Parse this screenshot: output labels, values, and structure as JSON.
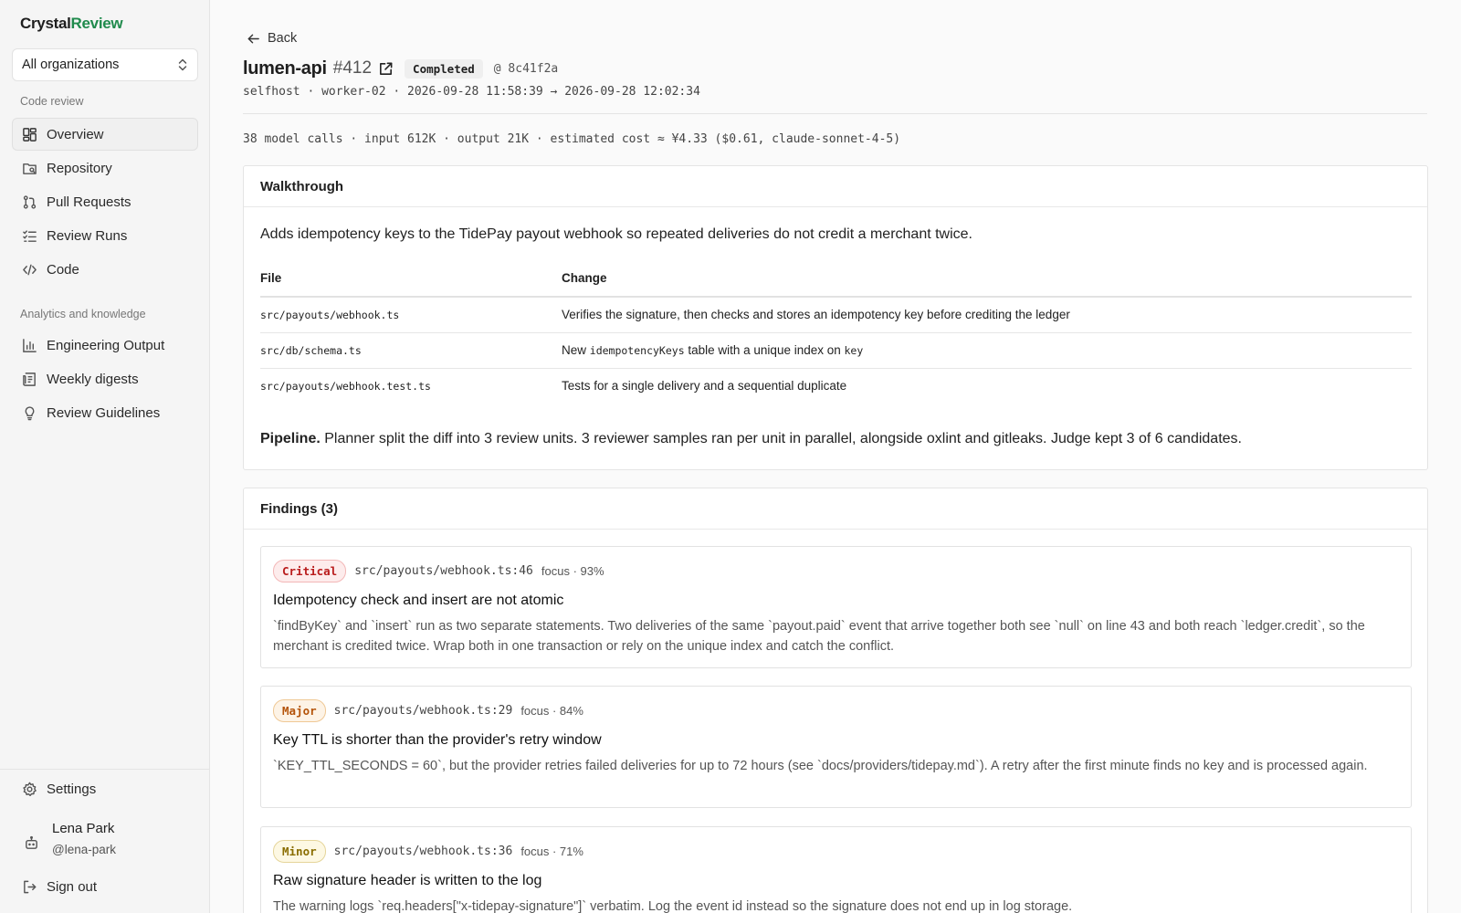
{
  "brand": {
    "part1": "Crystal",
    "part2": "Review"
  },
  "org_select": {
    "value": "All organizations"
  },
  "sidebar": {
    "section_code_review": "Code review",
    "code_items": [
      {
        "label": "Overview",
        "icon": "overview-grid-icon"
      },
      {
        "label": "Repository",
        "icon": "repository-icon"
      },
      {
        "label": "Pull Requests",
        "icon": "pull-request-icon"
      },
      {
        "label": "Review Runs",
        "icon": "checklist-icon"
      },
      {
        "label": "Code",
        "icon": "code-icon"
      }
    ],
    "section_analytics": "Analytics and knowledge",
    "analytics_items": [
      {
        "label": "Engineering Output",
        "icon": "bar-chart-icon"
      },
      {
        "label": "Weekly digests",
        "icon": "digest-icon"
      },
      {
        "label": "Review Guidelines",
        "icon": "lightbulb-icon"
      }
    ],
    "settings_label": "Settings",
    "user": {
      "name": "Lena Park",
      "handle": "@lena-park"
    },
    "signout_label": "Sign out"
  },
  "header": {
    "back_label": "Back",
    "repo": "lumen-api",
    "pr_number": "#412",
    "status": "Completed",
    "commit": "@ 8c41f2a",
    "meta": "selfhost · worker-02 · 2026-09-28 11:58:39 → 2026-09-28 12:02:34",
    "cost": "38 model calls · input 612K · output 21K · estimated cost ≈ ¥4.33 ($0.61, claude-sonnet-4-5)"
  },
  "walkthrough": {
    "title": "Walkthrough",
    "summary": "Adds idempotency keys to the TidePay payout webhook so repeated deliveries do not credit a merchant twice.",
    "col_file": "File",
    "col_change": "Change",
    "rows": [
      {
        "file": "src/payouts/webhook.ts",
        "change": "Verifies the signature, then checks and stores an idempotency key before crediting the ledger"
      },
      {
        "file": "src/db/schema.ts",
        "change_prefix": "New ",
        "change_code": "idempotencyKeys",
        "change_mid": " table with a unique index on ",
        "change_code2": "key"
      },
      {
        "file": "src/payouts/webhook.test.ts",
        "change": "Tests for a single delivery and a sequential duplicate"
      }
    ],
    "pipeline_label": "Pipeline.",
    "pipeline_text": "Planner split the diff into 3 review units. 3 reviewer samples ran per unit in parallel, alongside oxlint and gitleaks. Judge kept 3 of 6 candidates."
  },
  "findings": {
    "title": "Findings (3)",
    "items": [
      {
        "severity": "Critical",
        "location": "src/payouts/webhook.ts:46",
        "focus": "focus · 93%",
        "title": "Idempotency check and insert are not atomic",
        "body": "`findByKey` and `insert` run as two separate statements. Two deliveries of the same `payout.paid` event that arrive together both see `null` on line 43 and both reach `ledger.credit`, so the merchant is credited twice. Wrap both in one transaction or rely on the unique index and catch the conflict."
      },
      {
        "severity": "Major",
        "location": "src/payouts/webhook.ts:29",
        "focus": "focus · 84%",
        "title": "Key TTL is shorter than the provider's retry window",
        "body": "`KEY_TTL_SECONDS = 60`, but the provider retries failed deliveries for up to 72 hours (see `docs/providers/tidepay.md`). A retry after the first minute finds no key and is processed again."
      },
      {
        "severity": "Minor",
        "location": "src/payouts/webhook.ts:36",
        "focus": "focus · 71%",
        "title": "Raw signature header is written to the log",
        "body": "The warning logs `req.headers[\"x-tidepay-signature\"]` verbatim. Log the event id instead so the signature does not end up in log storage."
      }
    ]
  },
  "colors": {
    "brand_accent": "#1f8a4c",
    "critical": "#b91c1c",
    "major": "#b45309",
    "minor": "#8a6d00"
  }
}
